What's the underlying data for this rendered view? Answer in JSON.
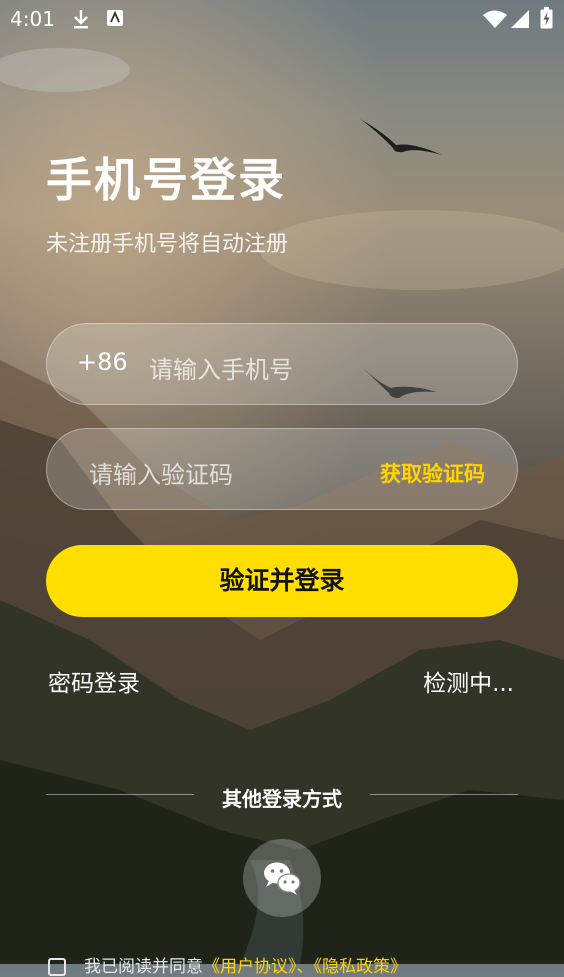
{
  "status_bar": {
    "time": "4:01"
  },
  "login": {
    "title": "手机号登录",
    "subtitle": "未注册手机号将自动注册",
    "country_code": "+86",
    "phone_placeholder": "请输入手机号",
    "code_placeholder": "请输入验证码",
    "get_code_label": "获取验证码",
    "submit_label": "验证并登录",
    "password_login_label": "密码登录",
    "detecting_label": "检测中...",
    "other_methods_label": "其他登录方式"
  },
  "agreement": {
    "prefix": "我已阅读并同意",
    "user_agreement": "《用户协议》",
    "separator": "、",
    "privacy_policy": "《隐私政策》"
  },
  "colors": {
    "accent": "#ffde00",
    "link": "#ffd400"
  }
}
